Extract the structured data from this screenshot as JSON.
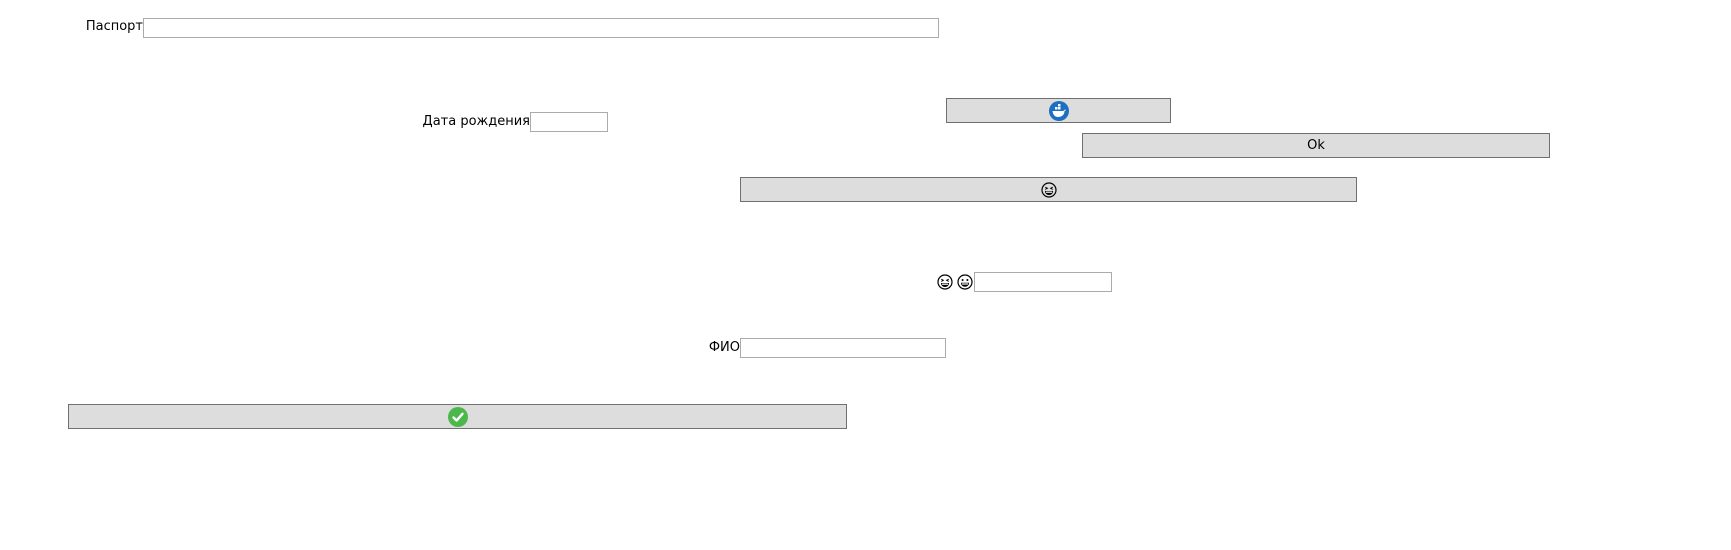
{
  "form": {
    "passport": {
      "label": "Паспорт",
      "value": ""
    },
    "birth_date": {
      "label": "Дата рождения",
      "value": ""
    },
    "emoji_field": {
      "value": ""
    },
    "fio": {
      "label": "ФИО",
      "value": ""
    }
  },
  "buttons": {
    "ok_label": "Ok"
  },
  "icons": {
    "docker_button_icon": "docker-whale-icon",
    "emoji_button_icon": "grinning-squint-face-icon",
    "emoji_label_icons": [
      "grinning-squint-face-icon",
      "grinning-face-icon"
    ],
    "check_button_icon": "check-circle-icon"
  },
  "colors": {
    "button_bg": "#dddddd",
    "docker_blue": "#1d6fc2",
    "check_green": "#4cb84c"
  }
}
